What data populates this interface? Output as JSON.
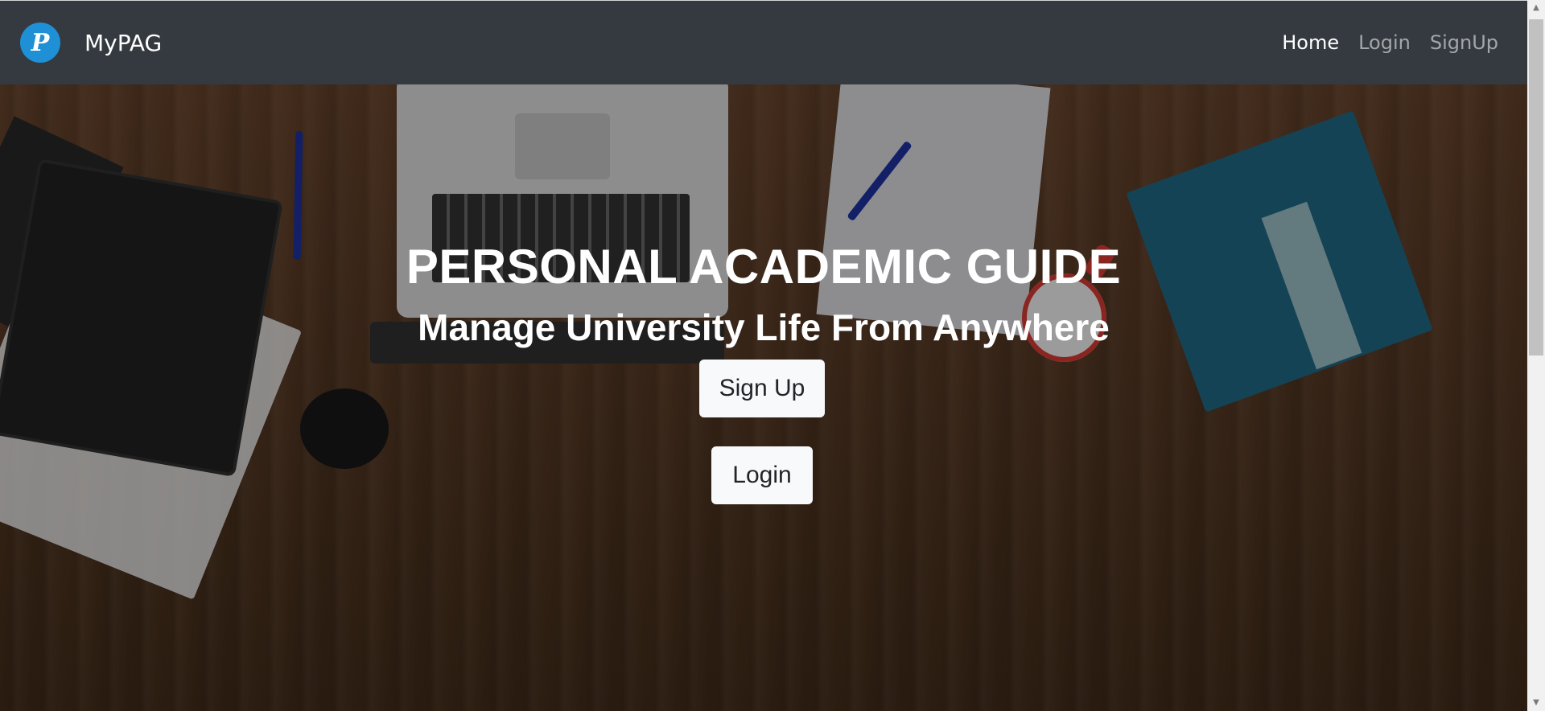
{
  "navbar": {
    "logo_glyph": "P",
    "brand": "MyPAG",
    "links": [
      {
        "label": "Home",
        "active": true
      },
      {
        "label": "Login",
        "active": false
      },
      {
        "label": "SignUp",
        "active": false
      }
    ],
    "bg_color": "#343a40"
  },
  "hero": {
    "title": "PERSONAL ACADEMIC GUIDE",
    "subtitle": "Manage University Life From Anywhere",
    "signup_button": "Sign Up",
    "login_button": "Login"
  },
  "colors": {
    "logo": "#1f8fd6",
    "button_bg": "#f8f9fa"
  }
}
